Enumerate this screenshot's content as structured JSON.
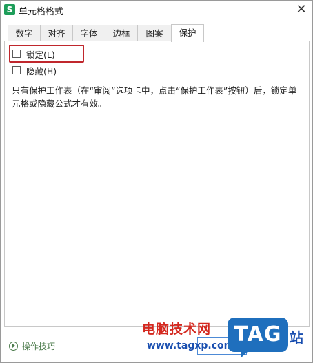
{
  "window": {
    "app_icon": "S",
    "title": "单元格格式",
    "close_glyph": "✕"
  },
  "tabs": [
    {
      "label": "数字"
    },
    {
      "label": "对齐"
    },
    {
      "label": "字体"
    },
    {
      "label": "边框"
    },
    {
      "label": "图案"
    },
    {
      "label": "保护",
      "active": true
    }
  ],
  "protection": {
    "lock": {
      "label": "锁定(L)",
      "checked": false
    },
    "hide": {
      "label": "隐藏(H)",
      "checked": false
    },
    "description": "只有保护工作表（在“审阅”选项卡中，点击“保护工作表”按钮）后，锁定单元格或隐藏公式才有效。"
  },
  "footer": {
    "tips_label": "操作技巧"
  },
  "watermark": {
    "site_name": "电脑技术网",
    "url": "www.tagxp.com",
    "tag": "TAG",
    "station": "站"
  },
  "colors": {
    "highlight": "#c0272d",
    "app_icon": "#1e9e5a",
    "tips": "#4a7a4a"
  }
}
